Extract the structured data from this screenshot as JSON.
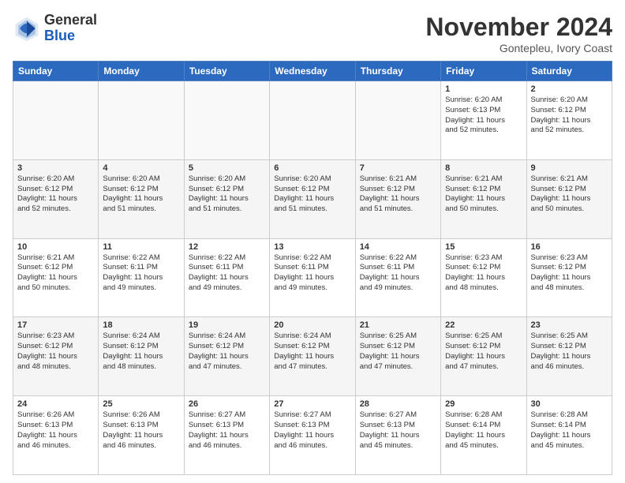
{
  "header": {
    "logo_general": "General",
    "logo_blue": "Blue",
    "month_title": "November 2024",
    "location": "Gontepleu, Ivory Coast"
  },
  "weekdays": [
    "Sunday",
    "Monday",
    "Tuesday",
    "Wednesday",
    "Thursday",
    "Friday",
    "Saturday"
  ],
  "rows": [
    [
      {
        "day": "",
        "info": ""
      },
      {
        "day": "",
        "info": ""
      },
      {
        "day": "",
        "info": ""
      },
      {
        "day": "",
        "info": ""
      },
      {
        "day": "",
        "info": ""
      },
      {
        "day": "1",
        "info": "Sunrise: 6:20 AM\nSunset: 6:13 PM\nDaylight: 11 hours\nand 52 minutes."
      },
      {
        "day": "2",
        "info": "Sunrise: 6:20 AM\nSunset: 6:12 PM\nDaylight: 11 hours\nand 52 minutes."
      }
    ],
    [
      {
        "day": "3",
        "info": "Sunrise: 6:20 AM\nSunset: 6:12 PM\nDaylight: 11 hours\nand 52 minutes."
      },
      {
        "day": "4",
        "info": "Sunrise: 6:20 AM\nSunset: 6:12 PM\nDaylight: 11 hours\nand 51 minutes."
      },
      {
        "day": "5",
        "info": "Sunrise: 6:20 AM\nSunset: 6:12 PM\nDaylight: 11 hours\nand 51 minutes."
      },
      {
        "day": "6",
        "info": "Sunrise: 6:20 AM\nSunset: 6:12 PM\nDaylight: 11 hours\nand 51 minutes."
      },
      {
        "day": "7",
        "info": "Sunrise: 6:21 AM\nSunset: 6:12 PM\nDaylight: 11 hours\nand 51 minutes."
      },
      {
        "day": "8",
        "info": "Sunrise: 6:21 AM\nSunset: 6:12 PM\nDaylight: 11 hours\nand 50 minutes."
      },
      {
        "day": "9",
        "info": "Sunrise: 6:21 AM\nSunset: 6:12 PM\nDaylight: 11 hours\nand 50 minutes."
      }
    ],
    [
      {
        "day": "10",
        "info": "Sunrise: 6:21 AM\nSunset: 6:12 PM\nDaylight: 11 hours\nand 50 minutes."
      },
      {
        "day": "11",
        "info": "Sunrise: 6:22 AM\nSunset: 6:11 PM\nDaylight: 11 hours\nand 49 minutes."
      },
      {
        "day": "12",
        "info": "Sunrise: 6:22 AM\nSunset: 6:11 PM\nDaylight: 11 hours\nand 49 minutes."
      },
      {
        "day": "13",
        "info": "Sunrise: 6:22 AM\nSunset: 6:11 PM\nDaylight: 11 hours\nand 49 minutes."
      },
      {
        "day": "14",
        "info": "Sunrise: 6:22 AM\nSunset: 6:11 PM\nDaylight: 11 hours\nand 49 minutes."
      },
      {
        "day": "15",
        "info": "Sunrise: 6:23 AM\nSunset: 6:12 PM\nDaylight: 11 hours\nand 48 minutes."
      },
      {
        "day": "16",
        "info": "Sunrise: 6:23 AM\nSunset: 6:12 PM\nDaylight: 11 hours\nand 48 minutes."
      }
    ],
    [
      {
        "day": "17",
        "info": "Sunrise: 6:23 AM\nSunset: 6:12 PM\nDaylight: 11 hours\nand 48 minutes."
      },
      {
        "day": "18",
        "info": "Sunrise: 6:24 AM\nSunset: 6:12 PM\nDaylight: 11 hours\nand 48 minutes."
      },
      {
        "day": "19",
        "info": "Sunrise: 6:24 AM\nSunset: 6:12 PM\nDaylight: 11 hours\nand 47 minutes."
      },
      {
        "day": "20",
        "info": "Sunrise: 6:24 AM\nSunset: 6:12 PM\nDaylight: 11 hours\nand 47 minutes."
      },
      {
        "day": "21",
        "info": "Sunrise: 6:25 AM\nSunset: 6:12 PM\nDaylight: 11 hours\nand 47 minutes."
      },
      {
        "day": "22",
        "info": "Sunrise: 6:25 AM\nSunset: 6:12 PM\nDaylight: 11 hours\nand 47 minutes."
      },
      {
        "day": "23",
        "info": "Sunrise: 6:25 AM\nSunset: 6:12 PM\nDaylight: 11 hours\nand 46 minutes."
      }
    ],
    [
      {
        "day": "24",
        "info": "Sunrise: 6:26 AM\nSunset: 6:13 PM\nDaylight: 11 hours\nand 46 minutes."
      },
      {
        "day": "25",
        "info": "Sunrise: 6:26 AM\nSunset: 6:13 PM\nDaylight: 11 hours\nand 46 minutes."
      },
      {
        "day": "26",
        "info": "Sunrise: 6:27 AM\nSunset: 6:13 PM\nDaylight: 11 hours\nand 46 minutes."
      },
      {
        "day": "27",
        "info": "Sunrise: 6:27 AM\nSunset: 6:13 PM\nDaylight: 11 hours\nand 46 minutes."
      },
      {
        "day": "28",
        "info": "Sunrise: 6:27 AM\nSunset: 6:13 PM\nDaylight: 11 hours\nand 45 minutes."
      },
      {
        "day": "29",
        "info": "Sunrise: 6:28 AM\nSunset: 6:14 PM\nDaylight: 11 hours\nand 45 minutes."
      },
      {
        "day": "30",
        "info": "Sunrise: 6:28 AM\nSunset: 6:14 PM\nDaylight: 11 hours\nand 45 minutes."
      }
    ]
  ]
}
